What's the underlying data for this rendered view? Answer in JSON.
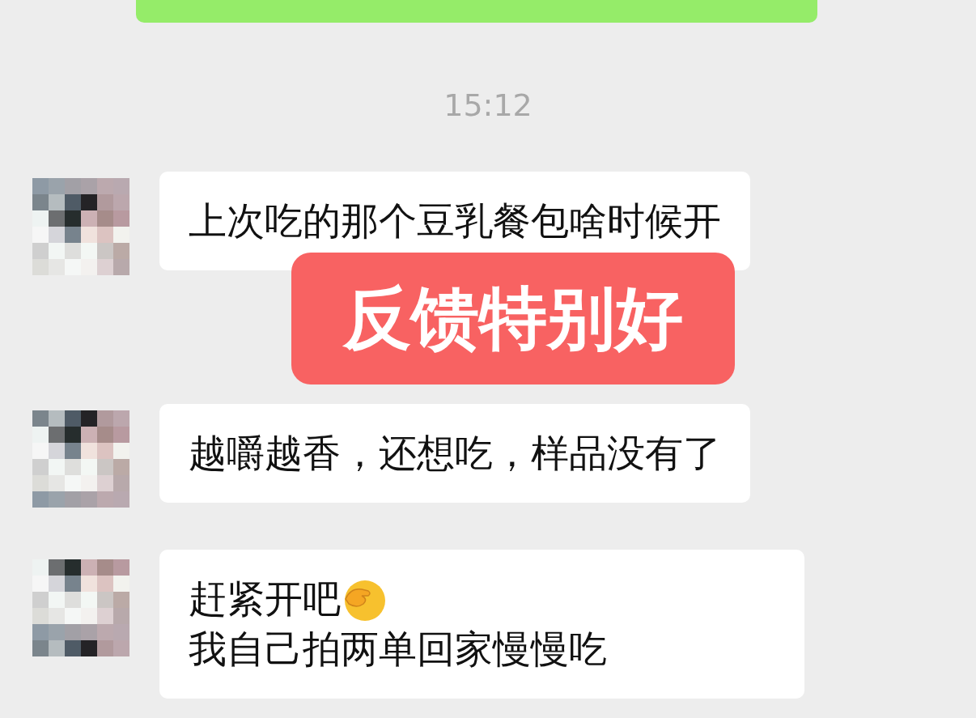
{
  "time": "15:12",
  "messages": [
    {
      "parts": [
        {
          "kind": "text",
          "text": "上次吃的那个豆乳餐包啥时候开"
        }
      ]
    },
    {
      "parts": [
        {
          "kind": "text",
          "text": "越嚼越香，还想吃，样品没有了"
        }
      ]
    },
    {
      "parts": [
        {
          "kind": "text",
          "text": "赶紧开吧"
        },
        {
          "kind": "emoji"
        },
        {
          "kind": "text",
          "text": "我自己拍两单回家慢慢吃"
        }
      ]
    }
  ],
  "sticker": {
    "text": "反馈特别好"
  }
}
